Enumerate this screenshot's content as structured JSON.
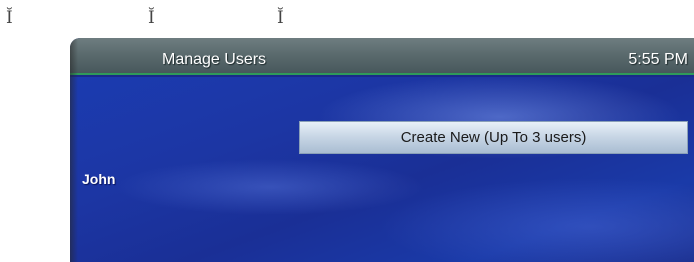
{
  "cursor_glyphs": [
    "Ĭ",
    "Ĭ",
    "Ĭ"
  ],
  "screen": {
    "title": "Manage Users",
    "clock": "5:55 PM",
    "create_button_label": "Create New (Up To 3 users)",
    "users": [
      "John"
    ]
  },
  "colors": {
    "title_bar": "#5a6a6d",
    "accent_line": "#2f9a5a",
    "background_blue": "#1c36a4",
    "button_face": "#c9d7e6"
  }
}
